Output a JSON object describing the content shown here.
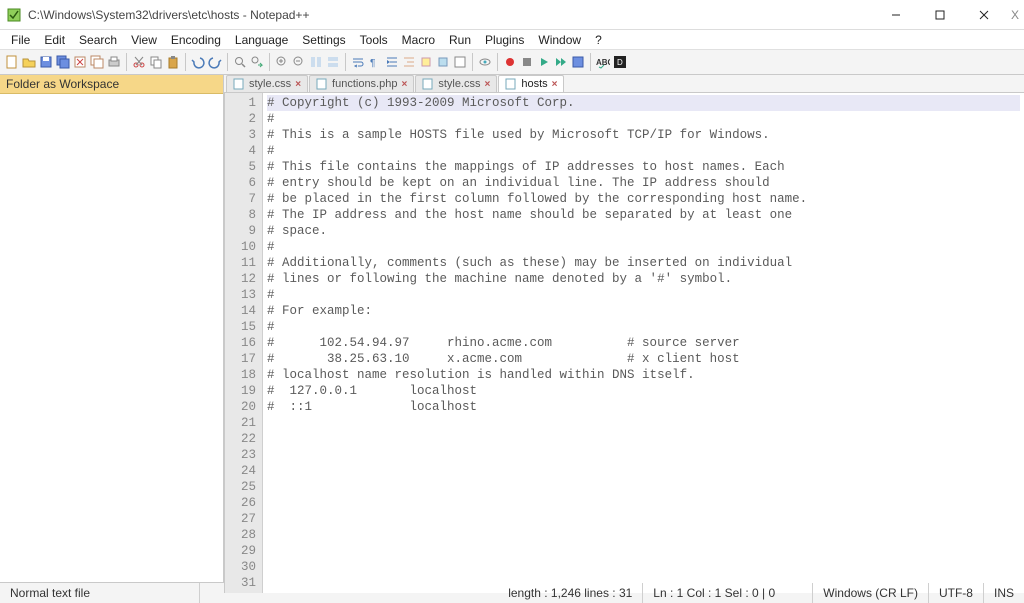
{
  "window": {
    "title": "C:\\Windows\\System32\\drivers\\etc\\hosts - Notepad++",
    "right_x": "X"
  },
  "menu": [
    "File",
    "Edit",
    "Search",
    "View",
    "Encoding",
    "Language",
    "Settings",
    "Tools",
    "Macro",
    "Run",
    "Plugins",
    "Window",
    "?"
  ],
  "toolbar_icons": [
    "new",
    "open",
    "save",
    "save-all",
    "close",
    "close-all",
    "print",
    "cut",
    "copy",
    "paste",
    "undo",
    "redo",
    "find",
    "replace",
    "zoom-in",
    "zoom-out",
    "sync",
    "word-wrap",
    "show-all",
    "indent-guide",
    "fold",
    "unfold",
    "bookmark",
    "record",
    "play",
    "run-script",
    "spell",
    "doc-switch"
  ],
  "sidebar": {
    "title": "Folder as Workspace"
  },
  "tabs": [
    {
      "label": "style.css",
      "active": false
    },
    {
      "label": "functions.php",
      "active": false
    },
    {
      "label": "style.css",
      "active": false
    },
    {
      "label": "hosts",
      "active": true
    }
  ],
  "editor": {
    "lines": [
      "# Copyright (c) 1993-2009 Microsoft Corp.",
      "#",
      "# This is a sample HOSTS file used by Microsoft TCP/IP for Windows.",
      "#",
      "# This file contains the mappings of IP addresses to host names. Each",
      "# entry should be kept on an individual line. The IP address should",
      "# be placed in the first column followed by the corresponding host name.",
      "# The IP address and the host name should be separated by at least one",
      "# space.",
      "#",
      "# Additionally, comments (such as these) may be inserted on individual",
      "# lines or following the machine name denoted by a '#' symbol.",
      "#",
      "# For example:",
      "#",
      "#      102.54.94.97     rhino.acme.com          # source server",
      "#       38.25.63.10     x.acme.com              # x client host",
      "# localhost name resolution is handled within DNS itself.",
      "#  127.0.0.1       localhost",
      "#  ::1             localhost",
      "",
      "",
      "",
      "",
      "",
      "",
      "",
      "",
      "",
      "",
      ""
    ],
    "total_visible_lines": 31
  },
  "status": {
    "filetype": "Normal text file",
    "length": "length : 1,246    lines : 31",
    "pos": "Ln : 1    Col : 1    Sel : 0 | 0",
    "eol": "Windows (CR LF)",
    "encoding": "UTF-8",
    "ins": "INS"
  },
  "colors": {
    "toolbar_bg": "#f4f4f4",
    "accent_orange": "#f6d788"
  }
}
